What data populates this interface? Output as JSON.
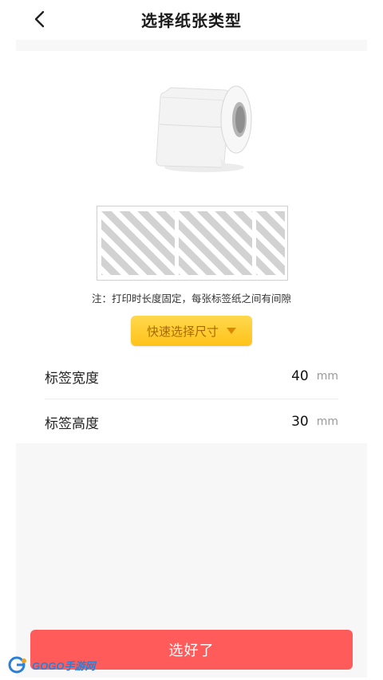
{
  "header": {
    "title": "选择纸张类型",
    "back_icon": "chevron-left-icon"
  },
  "preview": {
    "roll_image": "label-roll",
    "strip_label_count": 3,
    "note": "注：打印时长度固定，每张标签纸之间有间隙"
  },
  "quick_select": {
    "label": "快速选择尺寸",
    "icon": "caret-down-icon"
  },
  "fields": [
    {
      "label": "标签宽度",
      "value": "40",
      "unit": "mm"
    },
    {
      "label": "标签高度",
      "value": "30",
      "unit": "mm"
    }
  ],
  "confirm": {
    "label": "选好了"
  },
  "watermark": {
    "text": "GOGO手游网"
  },
  "colors": {
    "accent_red": "#ff5b5b",
    "accent_yellow": "#ffc21a",
    "panel_bg": "#f7f7f7"
  }
}
